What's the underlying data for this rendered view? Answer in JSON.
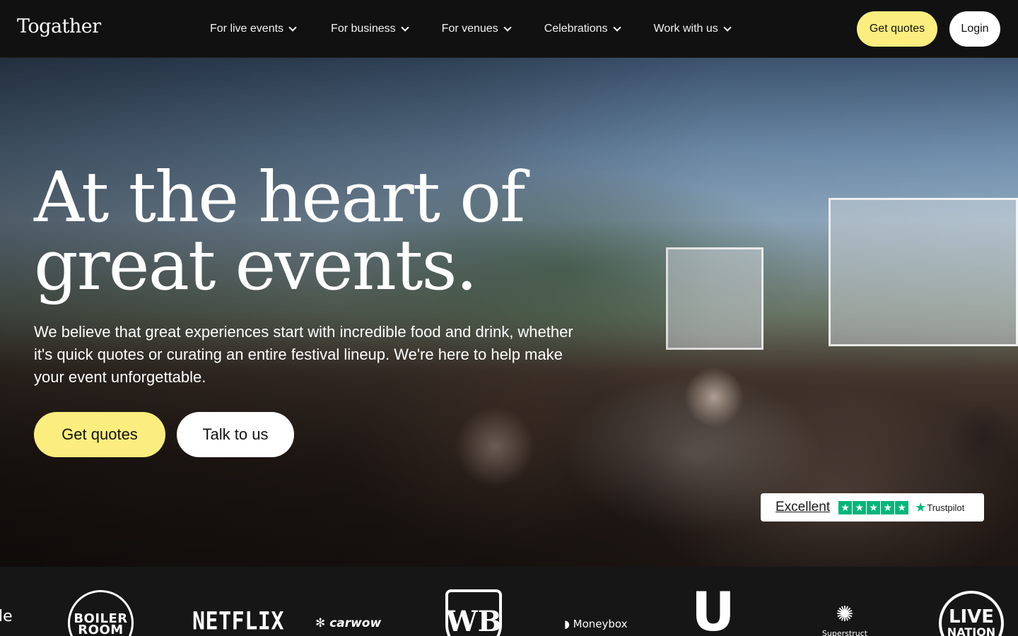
{
  "nav": {
    "logo": "Togather",
    "items": [
      {
        "label": "For live events"
      },
      {
        "label": "For business"
      },
      {
        "label": "For venues"
      },
      {
        "label": "Celebrations"
      },
      {
        "label": "Work with us"
      }
    ],
    "get_quotes": "Get quotes",
    "login": "Login"
  },
  "hero": {
    "headline_line1": "At the heart of",
    "headline_line2": "great events.",
    "subtitle": "We believe that great experiences start with incredible food and drink, whether it's quick quotes or curating an entire festival lineup. We're here to help make your event unforgettable.",
    "cta_primary": "Get quotes",
    "cta_secondary": "Talk to us"
  },
  "trustpilot": {
    "rating_label": "Excellent",
    "stars": 5,
    "brand": "Trustpilot"
  },
  "logos": {
    "partial": "le",
    "boiler_line1": "BOILER",
    "boiler_line2": "ROOM",
    "netflix": "NETFLIX",
    "carwow": "carwow",
    "wb": "WB",
    "moneybox": "Moneybox",
    "u": "U",
    "superstruct": "Superstruct",
    "live_line1": "LIVE",
    "live_line2": "NATION"
  },
  "colors": {
    "accent_yellow": "#fbee7e",
    "nav_bg": "#111111",
    "trustpilot_green": "#00b67a"
  }
}
